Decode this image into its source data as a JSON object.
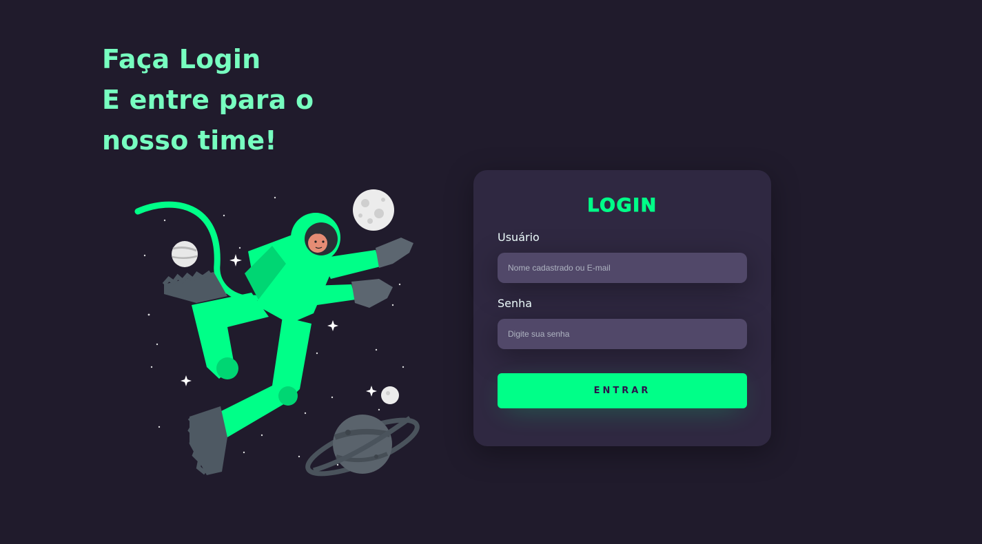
{
  "headline": {
    "line1": "Faça Login",
    "line2": "E entre para o",
    "line3": "nosso time!"
  },
  "illustration": {
    "icon": "astronaut-illustration"
  },
  "login": {
    "title": "LOGIN",
    "username_label": "Usuário",
    "username_placeholder": "Nome cadastrado ou E-mail",
    "password_label": "Senha",
    "password_placeholder": "Digite sua senha",
    "submit_label": "ENTRAR"
  },
  "colors": {
    "background": "#201b2c",
    "card": "#2f2841",
    "input": "#514869",
    "accent": "#00ff88",
    "headline": "#77ffc0"
  }
}
